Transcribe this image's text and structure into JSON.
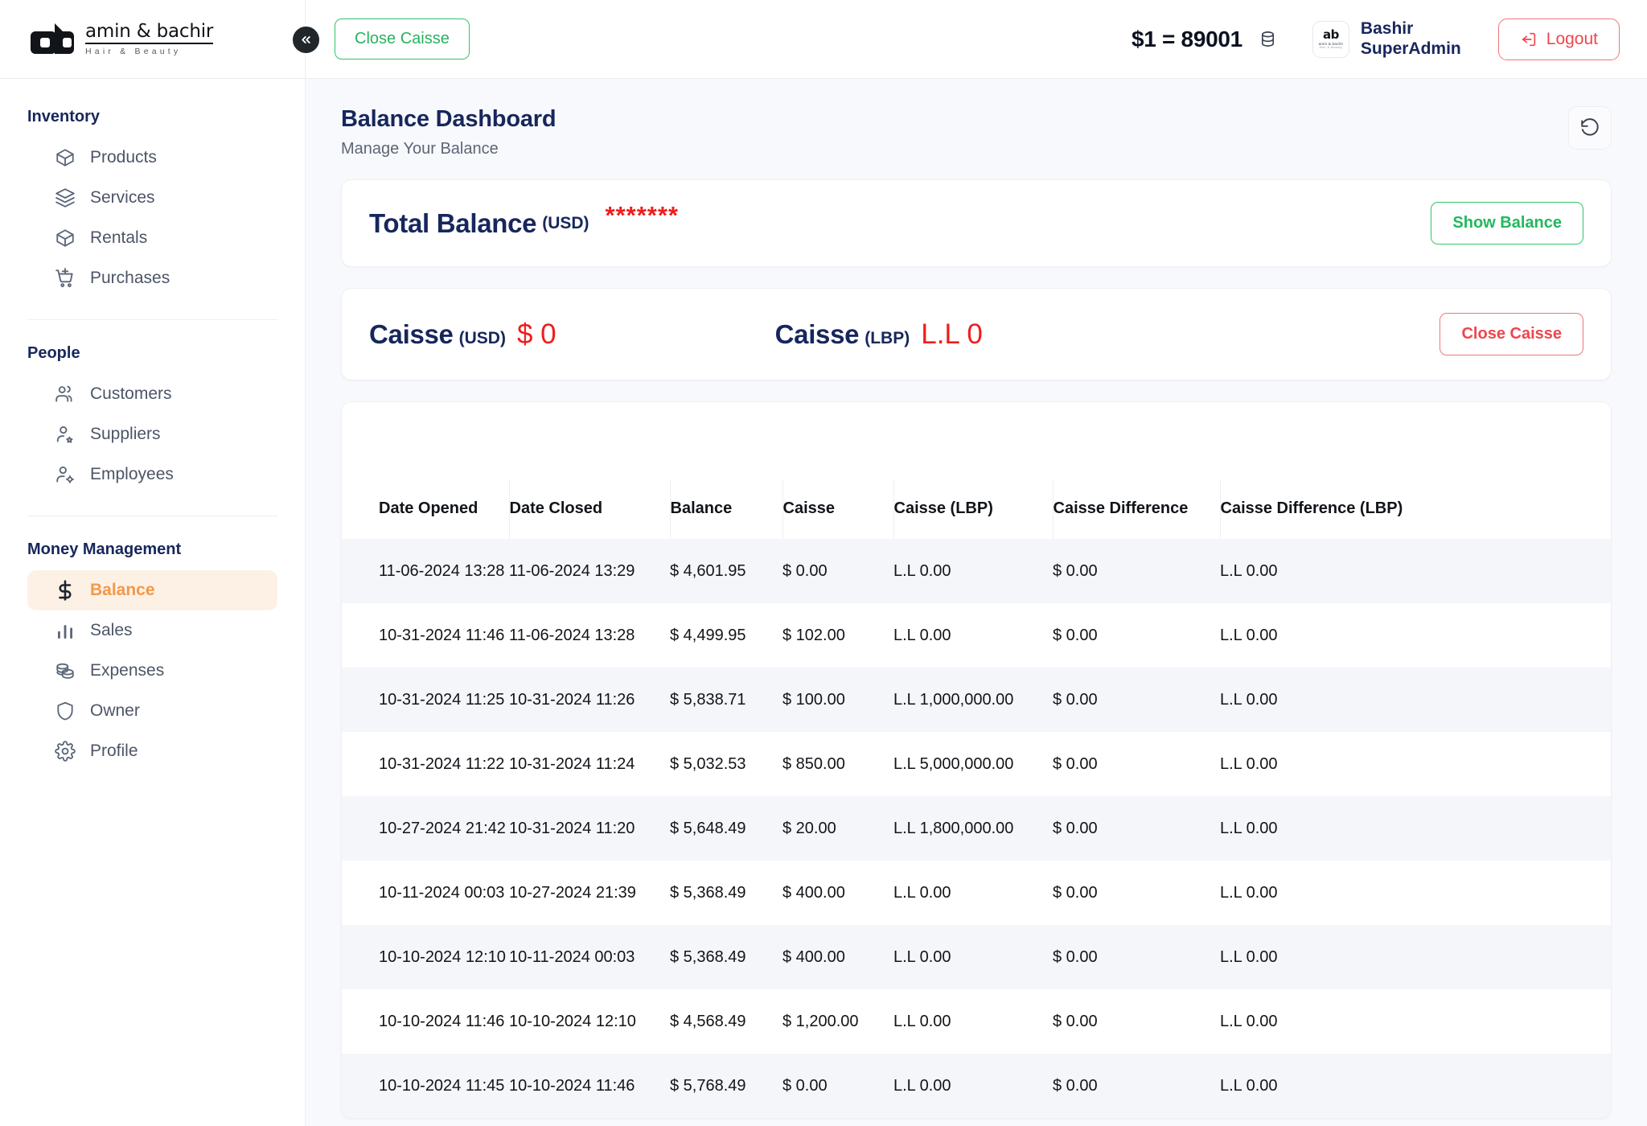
{
  "topbar": {
    "logo_name": "amin & bachir",
    "logo_sub": "Hair & Beauty",
    "collapse_icon": "chevron-double-left-icon",
    "close_caisse_label": "Close Caisse",
    "exchange_rate": "$1 = 89001",
    "database_icon": "database-icon",
    "avatar_initials": "ab",
    "avatar_sub": "amin & bachir",
    "avatar_sub2": "Hair & Beauty",
    "user_first_line": "Bashir",
    "user_second_line": "SuperAdmin",
    "logout_label": "Logout",
    "logout_icon": "logout-icon"
  },
  "sidebar": {
    "groups": [
      {
        "title": "Inventory",
        "items": [
          {
            "label": "Products",
            "icon": "box-icon",
            "active": false
          },
          {
            "label": "Services",
            "icon": "layers-icon",
            "active": false
          },
          {
            "label": "Rentals",
            "icon": "box-icon",
            "active": false
          },
          {
            "label": "Purchases",
            "icon": "cart-plus-icon",
            "active": false
          }
        ]
      },
      {
        "title": "People",
        "items": [
          {
            "label": "Customers",
            "icon": "users-icon",
            "active": false
          },
          {
            "label": "Suppliers",
            "icon": "user-star-icon",
            "active": false
          },
          {
            "label": "Employees",
            "icon": "user-gear-icon",
            "active": false
          }
        ]
      },
      {
        "title": "Money Management",
        "items": [
          {
            "label": "Balance",
            "icon": "dollar-icon",
            "active": true
          },
          {
            "label": "Sales",
            "icon": "bar-chart-icon",
            "active": false
          },
          {
            "label": "Expenses",
            "icon": "coins-icon",
            "active": false
          },
          {
            "label": "Owner",
            "icon": "shield-icon",
            "active": false
          },
          {
            "label": "Profile",
            "icon": "gear-icon",
            "active": false
          }
        ]
      }
    ]
  },
  "page": {
    "title": "Balance Dashboard",
    "subtitle": "Manage Your Balance",
    "refresh_icon": "refresh-ccw-icon"
  },
  "total_balance": {
    "label": "Total Balance",
    "currency": "(USD)",
    "masked_value": "*******",
    "button_label": "Show Balance"
  },
  "caisse": {
    "usd_label": "Caisse",
    "usd_currency": "(USD)",
    "usd_value": "$ 0",
    "lbp_label": "Caisse",
    "lbp_currency": "(LBP)",
    "lbp_value": "L.L 0",
    "button_label": "Close Caisse"
  },
  "table": {
    "columns": [
      "Date Opened",
      "Date Closed",
      "Balance",
      "Caisse",
      "Caisse (LBP)",
      "Caisse Difference",
      "Caisse Difference (LBP)"
    ],
    "rows": [
      {
        "date_opened": "11-06-2024 13:28",
        "date_closed": "11-06-2024 13:29",
        "balance": "$ 4,601.95",
        "caisse": "$ 0.00",
        "caisse_lbp": "L.L 0.00",
        "diff": "$ 0.00",
        "diff_lbp": "L.L 0.00"
      },
      {
        "date_opened": "10-31-2024 11:46",
        "date_closed": "11-06-2024 13:28",
        "balance": "$ 4,499.95",
        "caisse": "$ 102.00",
        "caisse_lbp": "L.L 0.00",
        "diff": "$ 0.00",
        "diff_lbp": "L.L 0.00"
      },
      {
        "date_opened": "10-31-2024 11:25",
        "date_closed": "10-31-2024 11:26",
        "balance": "$ 5,838.71",
        "caisse": "$ 100.00",
        "caisse_lbp": "L.L 1,000,000.00",
        "diff": "$ 0.00",
        "diff_lbp": "L.L 0.00"
      },
      {
        "date_opened": "10-31-2024 11:22",
        "date_closed": "10-31-2024 11:24",
        "balance": "$ 5,032.53",
        "caisse": "$ 850.00",
        "caisse_lbp": "L.L 5,000,000.00",
        "diff": "$ 0.00",
        "diff_lbp": "L.L 0.00"
      },
      {
        "date_opened": "10-27-2024 21:42",
        "date_closed": "10-31-2024 11:20",
        "balance": "$ 5,648.49",
        "caisse": "$ 20.00",
        "caisse_lbp": "L.L 1,800,000.00",
        "diff": "$ 0.00",
        "diff_lbp": "L.L 0.00"
      },
      {
        "date_opened": "10-11-2024 00:03",
        "date_closed": "10-27-2024 21:39",
        "balance": "$ 5,368.49",
        "caisse": "$ 400.00",
        "caisse_lbp": "L.L 0.00",
        "diff": "$ 0.00",
        "diff_lbp": "L.L 0.00"
      },
      {
        "date_opened": "10-10-2024 12:10",
        "date_closed": "10-11-2024 00:03",
        "balance": "$ 5,368.49",
        "caisse": "$ 400.00",
        "caisse_lbp": "L.L 0.00",
        "diff": "$ 0.00",
        "diff_lbp": "L.L 0.00"
      },
      {
        "date_opened": "10-10-2024 11:46",
        "date_closed": "10-10-2024 12:10",
        "balance": "$ 4,568.49",
        "caisse": "$ 1,200.00",
        "caisse_lbp": "L.L 0.00",
        "diff": "$ 0.00",
        "diff_lbp": "L.L 0.00"
      },
      {
        "date_opened": "10-10-2024 11:45",
        "date_closed": "10-10-2024 11:46",
        "balance": "$ 5,768.49",
        "caisse": "$ 0.00",
        "caisse_lbp": "L.L 0.00",
        "diff": "$ 0.00",
        "diff_lbp": "L.L 0.00"
      }
    ]
  },
  "colors": {
    "accent_orange": "#f2994a",
    "green": "#1db954",
    "red": "#f21c1c",
    "navy": "#17275c",
    "bg": "#f8f9fc"
  }
}
